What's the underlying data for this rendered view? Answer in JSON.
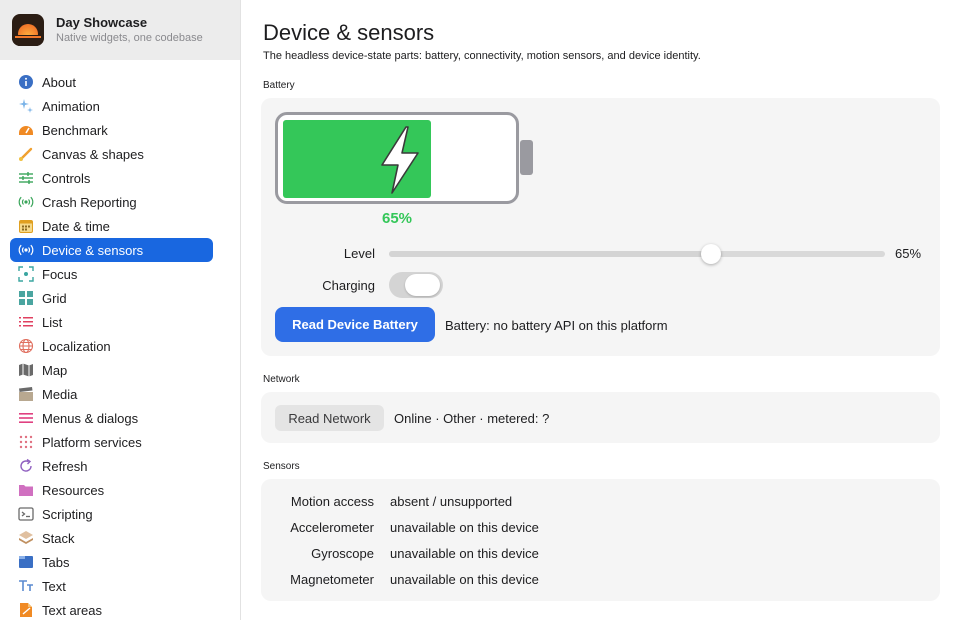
{
  "app": {
    "title": "Day Showcase",
    "subtitle": "Native widgets, one codebase"
  },
  "sidebar": {
    "items": [
      {
        "label": "About",
        "icon": "info-icon",
        "color": "#3a6fc4"
      },
      {
        "label": "Animation",
        "icon": "sparkles-icon",
        "color": "#7ab3e8"
      },
      {
        "label": "Benchmark",
        "icon": "speedometer-icon",
        "color": "#f08a24"
      },
      {
        "label": "Canvas & shapes",
        "icon": "paintbrush-icon",
        "color": "#f0a030"
      },
      {
        "label": "Controls",
        "icon": "sliders-icon",
        "color": "#3aa55a"
      },
      {
        "label": "Crash Reporting",
        "icon": "broadcast-icon",
        "color": "#3aa55a"
      },
      {
        "label": "Date & time",
        "icon": "calendar-icon",
        "color": "#e0a020"
      },
      {
        "label": "Device & sensors",
        "icon": "broadcast-icon",
        "color": "#ffffff",
        "active": true
      },
      {
        "label": "Focus",
        "icon": "focus-icon",
        "color": "#3aa5a0"
      },
      {
        "label": "Grid",
        "icon": "grid-icon",
        "color": "#4aa5a0"
      },
      {
        "label": "List",
        "icon": "list-icon",
        "color": "#e04060"
      },
      {
        "label": "Localization",
        "icon": "globe-icon",
        "color": "#e07060"
      },
      {
        "label": "Map",
        "icon": "map-icon",
        "color": "#6a6a6a"
      },
      {
        "label": "Media",
        "icon": "clapperboard-icon",
        "color": "#b8a890"
      },
      {
        "label": "Menus & dialogs",
        "icon": "menu-icon",
        "color": "#e04080"
      },
      {
        "label": "Platform services",
        "icon": "dots-grid-icon",
        "color": "#e07080"
      },
      {
        "label": "Refresh",
        "icon": "refresh-icon",
        "color": "#9060c0"
      },
      {
        "label": "Resources",
        "icon": "folder-icon",
        "color": "#d070c0"
      },
      {
        "label": "Scripting",
        "icon": "terminal-icon",
        "color": "#6a6a6a"
      },
      {
        "label": "Stack",
        "icon": "stack-icon",
        "color": "#c09060"
      },
      {
        "label": "Tabs",
        "icon": "tabs-icon",
        "color": "#3a6fc4"
      },
      {
        "label": "Text",
        "icon": "text-icon",
        "color": "#5a8ad0"
      },
      {
        "label": "Text areas",
        "icon": "document-icon",
        "color": "#f08a24"
      }
    ]
  },
  "page": {
    "title": "Device & sensors",
    "description": "The headless device-state parts: battery, connectivity, motion sensors, and device identity."
  },
  "battery": {
    "section_label": "Battery",
    "level_fraction": 0.65,
    "percent_label": "65%",
    "level_label": "Level",
    "level_value": "65%",
    "charging_label": "Charging",
    "charging": false,
    "read_button": "Read Device Battery",
    "status": "Battery: no battery API on this platform",
    "fill_color": "#34c759"
  },
  "network": {
    "section_label": "Network",
    "read_button": "Read Network",
    "status": "Online · Other · metered: ?"
  },
  "sensors": {
    "section_label": "Sensors",
    "rows": [
      {
        "label": "Motion access",
        "value": "absent / unsupported"
      },
      {
        "label": "Accelerometer",
        "value": "unavailable on this device"
      },
      {
        "label": "Gyroscope",
        "value": "unavailable on this device"
      },
      {
        "label": "Magnetometer",
        "value": "unavailable on this device"
      }
    ]
  },
  "colors": {
    "accent": "#1967e0",
    "primary_button": "#2f6ee6"
  }
}
